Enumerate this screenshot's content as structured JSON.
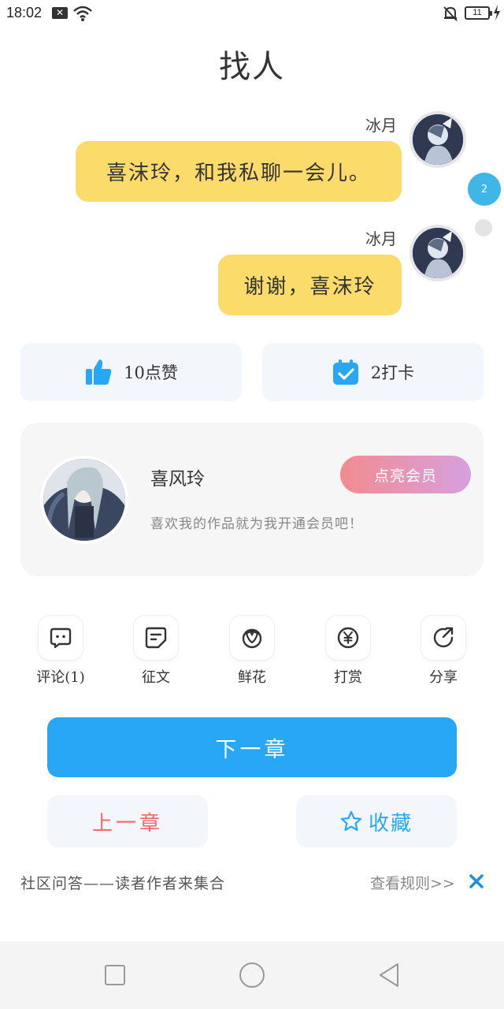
{
  "status_bar": {
    "time": "18:02",
    "notification_icon": "close-box-icon",
    "wifi_icon": "wifi-icon",
    "mute_icon": "bell-muted-icon",
    "battery": "11",
    "charging_icon": "lightning-icon"
  },
  "page_title": "找人",
  "messages": [
    {
      "sender": "冰月",
      "text": "喜沫玲，和我私聊一会儿。"
    },
    {
      "sender": "冰月",
      "text": "谢谢，喜沫玲"
    }
  ],
  "floating": {
    "badge": "2"
  },
  "stats": {
    "likes": "10点赞",
    "checkins": "2打卡"
  },
  "author": {
    "name": "喜风玲",
    "slogan": "喜欢我的作品就为我开通会员吧！",
    "vip_button": "点亮会员"
  },
  "actions": [
    {
      "label": "评论(1)",
      "icon": "comment-icon"
    },
    {
      "label": "征文",
      "icon": "essay-icon"
    },
    {
      "label": "鲜花",
      "icon": "flower-icon"
    },
    {
      "label": "打赏",
      "icon": "yen-coin-icon"
    },
    {
      "label": "分享",
      "icon": "share-icon"
    }
  ],
  "buttons": {
    "next": "下一章",
    "prev": "上一章",
    "favorite": "收藏"
  },
  "community": {
    "text": "社区问答——读者作者来集合",
    "rules": "查看规则>>"
  },
  "colors": {
    "accent": "#27a7f5",
    "bubble": "#fbdc6b",
    "prev_text": "#f26a6a"
  }
}
